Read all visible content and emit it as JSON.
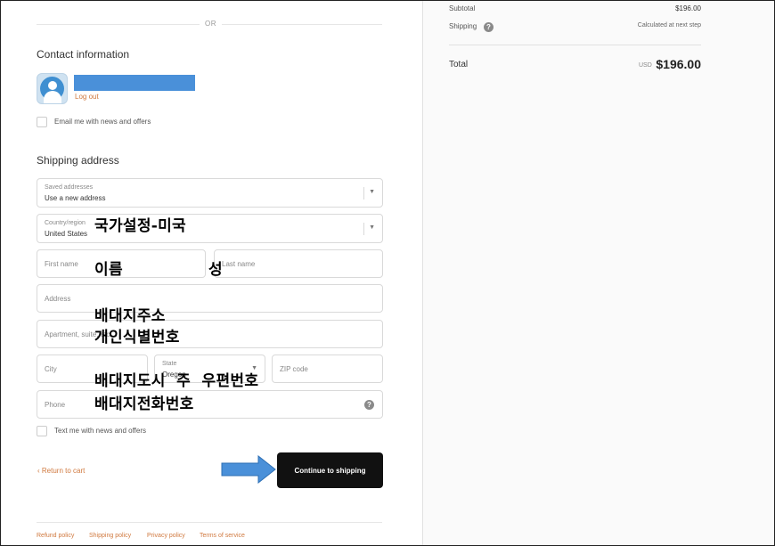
{
  "divider_text": "OR",
  "contact": {
    "title": "Contact information",
    "logout_label": "Log out",
    "email_opt_in": "Email me with news and offers"
  },
  "shipping": {
    "title": "Shipping address",
    "saved_addresses": {
      "label": "Saved addresses",
      "value": "Use a new address"
    },
    "country": {
      "label": "Country/region",
      "value": "United States"
    },
    "first_name_placeholder": "First name",
    "last_name_placeholder": "Last name",
    "address_placeholder": "Address",
    "apartment_placeholder": "Apartment, suite, etc.",
    "city_placeholder": "City",
    "state": {
      "label": "State",
      "value": "Oregon"
    },
    "zip_placeholder": "ZIP code",
    "phone_placeholder": "Phone",
    "sms_opt_in": "Text me with news and offers"
  },
  "annotations": {
    "country": "국가설정-미국",
    "first_name": "이름",
    "last_name": "성",
    "address": "배대지주소",
    "apartment": "개인식별번호",
    "city_row": "배대지도시  주  우편번호",
    "phone": "배대지전화번호"
  },
  "actions": {
    "return_label": "Return to cart",
    "continue_label": "Continue to shipping"
  },
  "footer": {
    "links": [
      "Refund policy",
      "Shipping policy",
      "Privacy policy",
      "Terms of service"
    ]
  },
  "summary": {
    "subtotal_label": "Subtotal",
    "subtotal_value": "$196.00",
    "shipping_label": "Shipping",
    "shipping_value": "Calculated at next step",
    "total_label": "Total",
    "currency": "USD",
    "total_value": "$196.00"
  },
  "colors": {
    "accent_link": "#d0793f",
    "button_bg": "#111111",
    "annotation_arrow": "#4a90d9"
  }
}
